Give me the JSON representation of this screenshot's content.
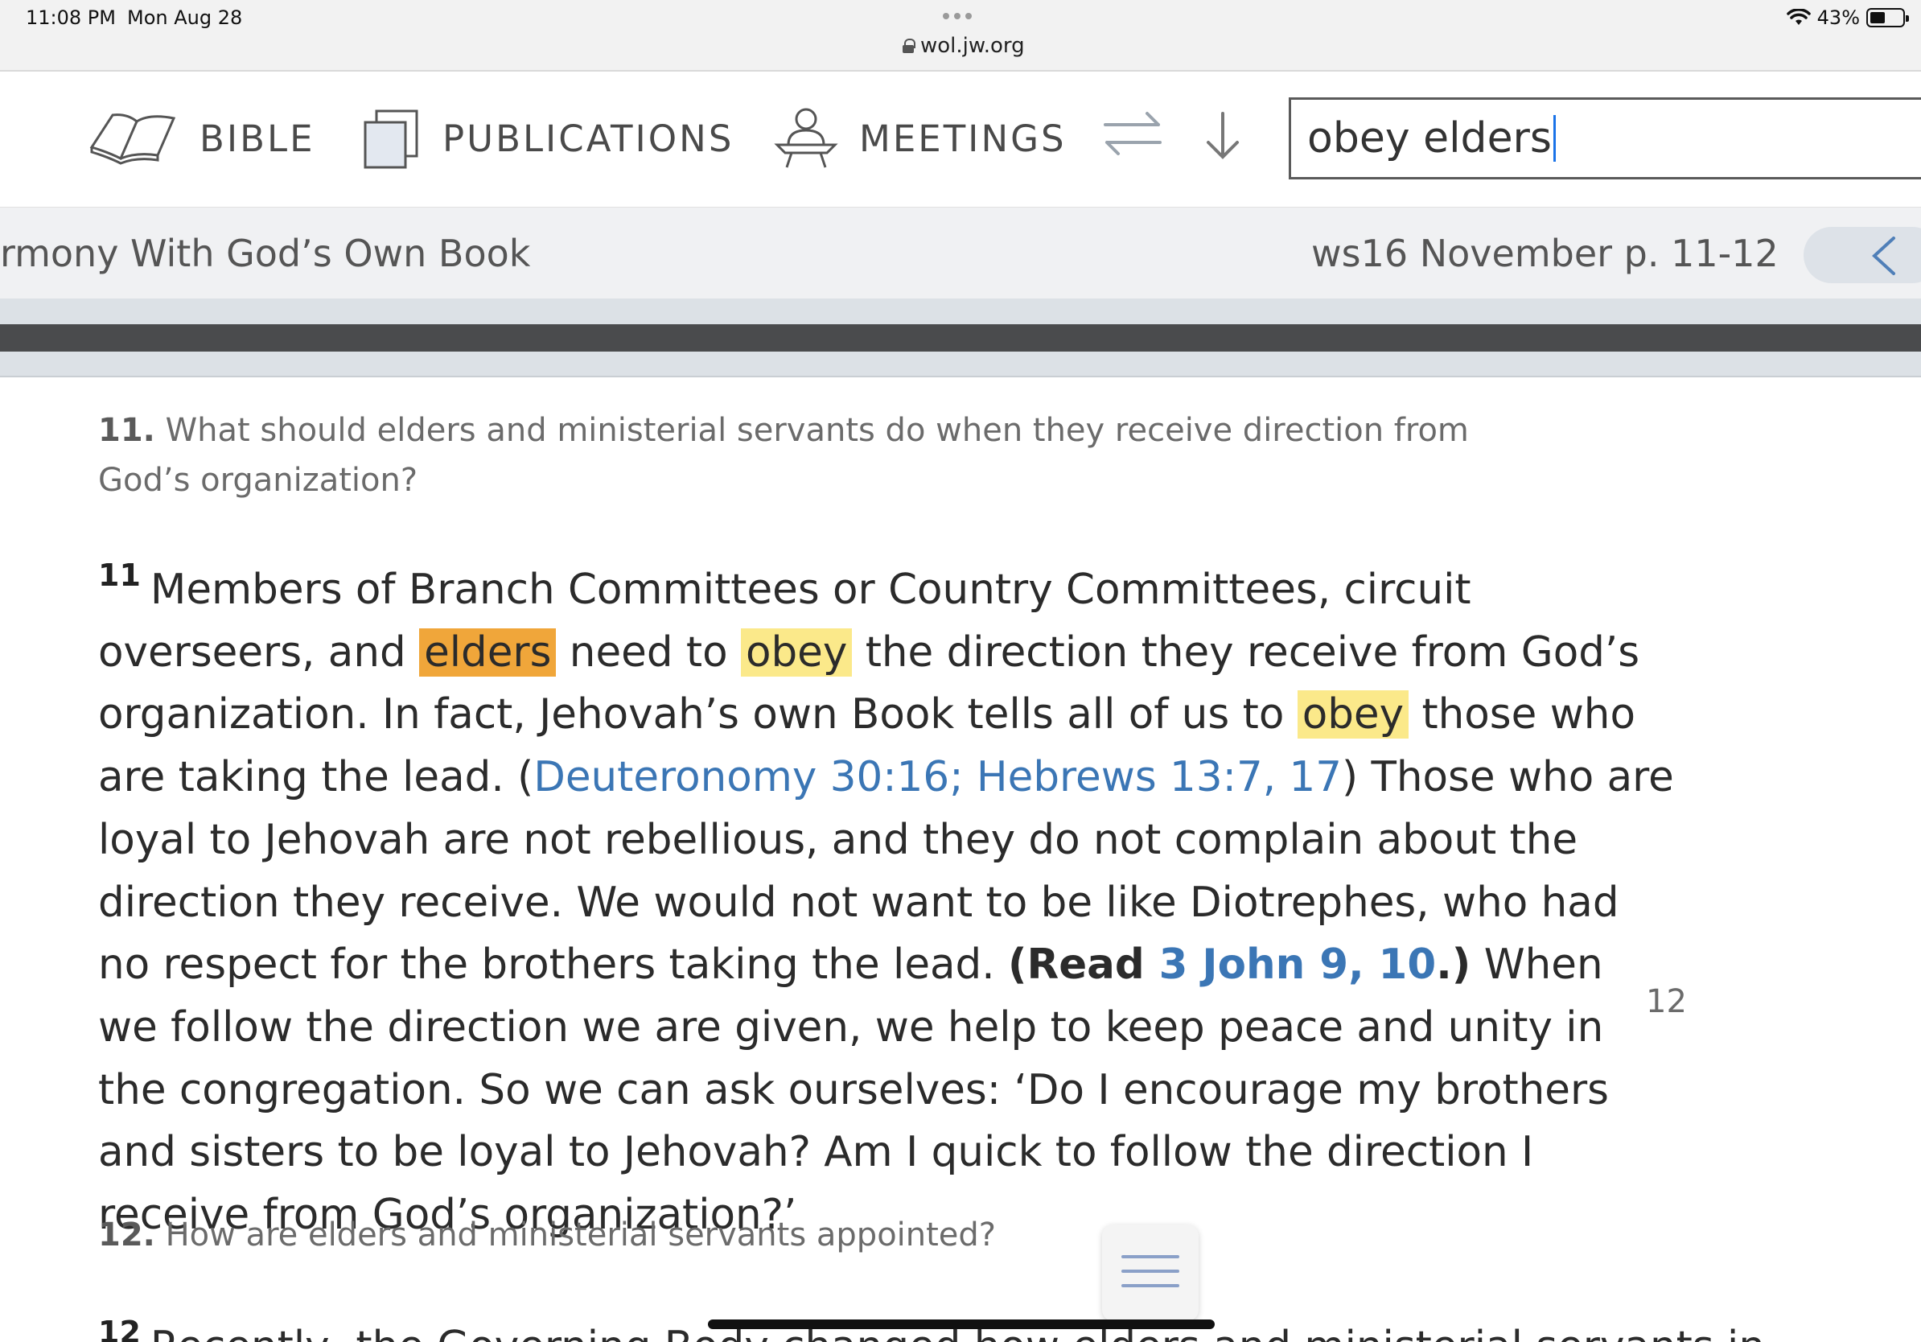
{
  "status_bar": {
    "time": "11:08 PM",
    "date": "Mon Aug 28",
    "url": "wol.jw.org",
    "battery": "43%"
  },
  "nav": {
    "bible": "BIBLE",
    "publications": "PUBLICATIONS",
    "meetings": "MEETINGS",
    "search_value": "obey elders"
  },
  "breadcrumb": {
    "title": "rmony With God’s Own Book",
    "reference": "ws16 November p. 11-12"
  },
  "article": {
    "q11_num": "11.",
    "q11_text": "What should elders and ministerial servants do when they receive direction from God’s organization?",
    "p11": {
      "num": "11",
      "t1": "Members of Branch Committees or Country Committees, circuit overseers, and ",
      "hl_elders": "elders",
      "t2": " need to ",
      "hl_obey1": "obey",
      "t3": " the direction they receive from God’s organization. In fact, Jehovah’s own Book tells all of us to ",
      "hl_obey2": "obey",
      "t4": " those who are taking the lead. (",
      "link_refs": "Deuteronomy 30:16; Hebrews 13:7, 17",
      "t5": ") Those who are loyal to Jehovah are not rebellious, and they do not complain about the direction they receive. We would not want to be like Diotrephes, who had no respect for the brothers taking the lead. ",
      "read_open": "(Read ",
      "link_read": "3 John 9, 10",
      "read_close": ".)",
      "t6": " When we follow the direction we are given, we help to keep peace and unity in the congregation. So we can ask ourselves: ‘Do I encourage my brothers and sisters to be loyal to Jehovah? Am I quick to follow the direction I receive from God’s organization?’"
    },
    "page_marker": "12",
    "q12_num": "12.",
    "q12_text": "How are elders and ministerial servants appointed?",
    "p12_num": "12",
    "p12_text": "Recently, the Governing Body changed how elders and ministerial servants in"
  }
}
